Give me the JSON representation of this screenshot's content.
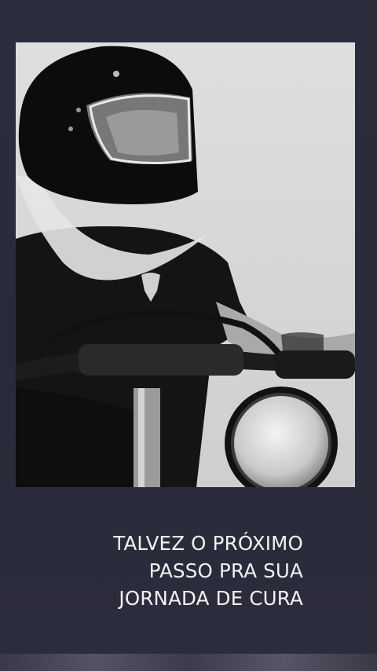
{
  "caption": {
    "lines": [
      "TALVEZ O PRÓXIMO",
      "PASSO PRA SUA",
      "JORNADA DE CURA"
    ]
  },
  "colors": {
    "background": "#2b2c3c",
    "caption_text": "#f2f2f2",
    "photo_sky": "#d9d9d9"
  }
}
